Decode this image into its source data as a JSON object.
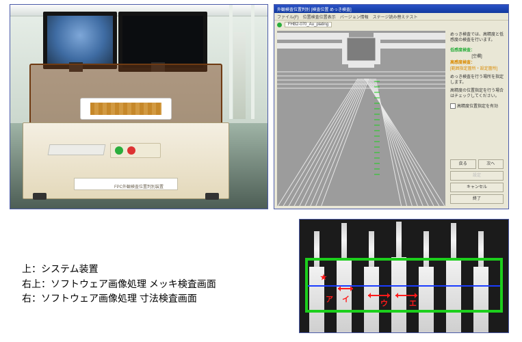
{
  "photo": {
    "machine_label": "FPC外観検査位置判別装置"
  },
  "swin": {
    "title": "外観検査位置判別  [検査位置 めっき検査]",
    "menu": [
      "ファイル(F)",
      "位置検査位置表示",
      "バージョン情報",
      "ステージ読み替えテスト"
    ],
    "status": "●",
    "filename": "FHB2-070_Au_plating",
    "side": {
      "intro": "めっき検査では、高精度と低感度の検査を行います。",
      "low_label": "低感度検査：",
      "low_value": "[空欄]",
      "high_label": "高感度検査：",
      "high_value": "[範囲指定箇所・設定箇所]",
      "note1": "めっき検査を行う場所を指定します。",
      "note2": "高精度の位置指定を行う場合はチェックしてください。",
      "check_label": "高精度位置指定を有効"
    },
    "buttons": {
      "back": "戻る",
      "next": "次へ",
      "placeholder": "設定",
      "cancel": "キャンセル",
      "close": "終了"
    }
  },
  "dims": {
    "annotations": [
      "ア",
      "イ",
      "ウ",
      "エ"
    ],
    "star": "★"
  },
  "caption": {
    "line1": "上：システム装置",
    "line2": "右上：ソフトウェア画像処理 メッキ検査画面",
    "line3": "右：ソフトウェア画像処理 寸法検査画面"
  }
}
